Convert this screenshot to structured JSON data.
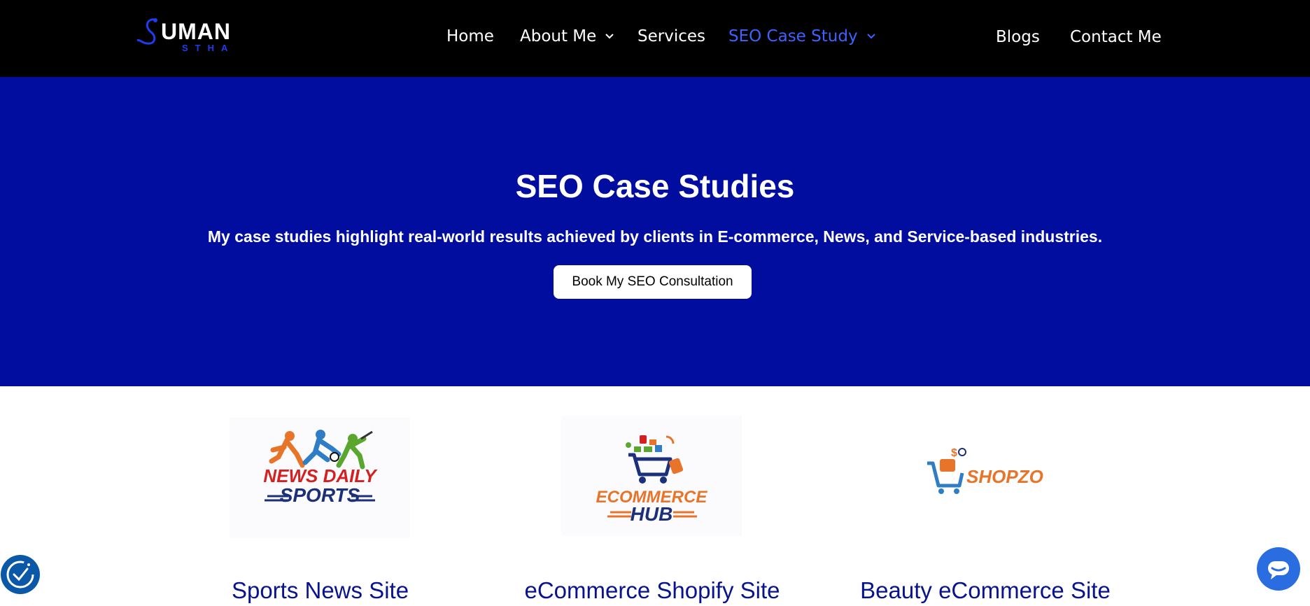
{
  "header": {
    "logo": {
      "main": "UMAN",
      "sub": "STHA"
    },
    "nav": {
      "home": "Home",
      "about": "About Me",
      "services": "Services",
      "seo_case_study": "SEO Case Study",
      "blogs": "Blogs",
      "contact": "Contact Me"
    },
    "active_item": "SEO Case Study"
  },
  "hero": {
    "title": "SEO Case Studies",
    "subtitle": "My case studies highlight real-world results achieved by clients in E-commerce, News, and Service-based industries.",
    "cta_label": "Book My SEO Consultation"
  },
  "cards": [
    {
      "title": "Sports News Site",
      "logo_text_1": "NEWS DAILY",
      "logo_text_2": "SPORTS",
      "icon": "sports-players-logo"
    },
    {
      "title": "eCommerce Shopify Site",
      "logo_text_1": "ECOMMERCE",
      "logo_text_2": "HUB",
      "icon": "shopping-cart-logo"
    },
    {
      "title": "Beauty eCommerce Site",
      "logo_text_1": "SHOPZO",
      "icon": "shopping-cart-logo"
    }
  ],
  "floating": {
    "accessibility_icon": "accessibility-icon",
    "chat_icon": "chat-icon"
  },
  "colors": {
    "header_bg": "#000000",
    "hero_bg": "#000d9e",
    "accent": "#3d63ff",
    "card_title": "#08148f"
  }
}
